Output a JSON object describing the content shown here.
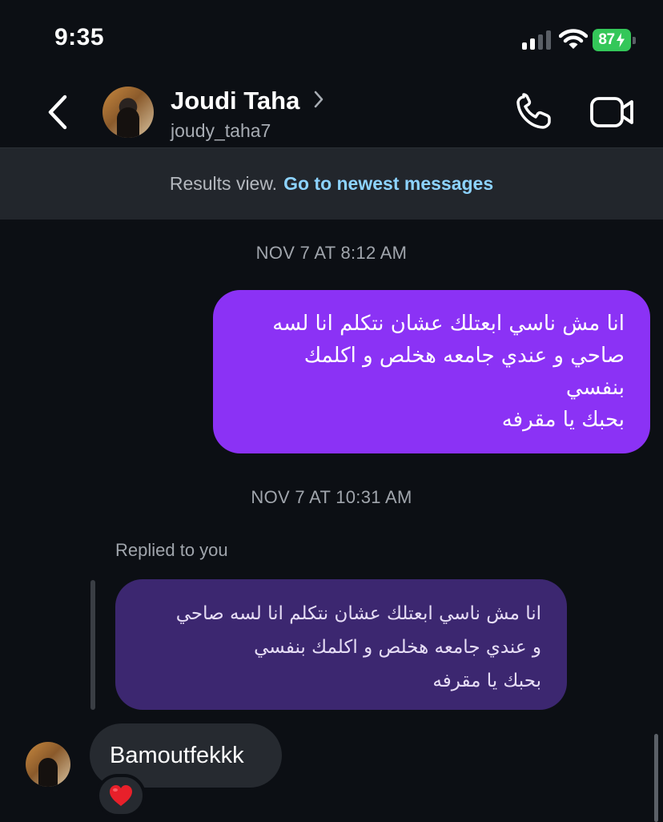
{
  "status_bar": {
    "time": "9:35",
    "battery_level": "87",
    "icons": [
      "signal-icon",
      "wifi-icon",
      "battery-charging-icon"
    ]
  },
  "header": {
    "contact_name": "Joudi Taha",
    "handle": "joudy_taha7",
    "icons": [
      "back-chevron-icon",
      "avatar",
      "chevron-right-icon",
      "phone-icon",
      "video-camera-icon"
    ]
  },
  "results_banner": {
    "label": "Results view.",
    "link": "Go to newest messages"
  },
  "messages": {
    "timestamp_1": "NOV 7 AT 8:12 AM",
    "sent_lines": [
      "انا مش ناسي ابعتلك عشان نتكلم انا لسه",
      "صاحي و عندي جامعه هخلص و اكلمك",
      "بنفسي",
      "بحبك يا مقرفه"
    ],
    "timestamp_2": "NOV 7 AT 10:31 AM",
    "replied_label": "Replied to you",
    "quoted_lines": [
      "انا مش ناسي ابعتلك عشان نتكلم انا لسه صاحي",
      "و عندي جامعه هخلص و اكلمك بنفسي",
      "بحبك يا مقرفه"
    ],
    "received_text": "Bamoutfekkk",
    "reaction": "heart-emoji"
  },
  "colors": {
    "background": "#0c0f14",
    "sent_bubble": "#8b32f5",
    "quoted_bubble": "#3c2770",
    "received_bubble": "#262a30",
    "link": "#8dd3ff",
    "battery": "#34c759"
  }
}
